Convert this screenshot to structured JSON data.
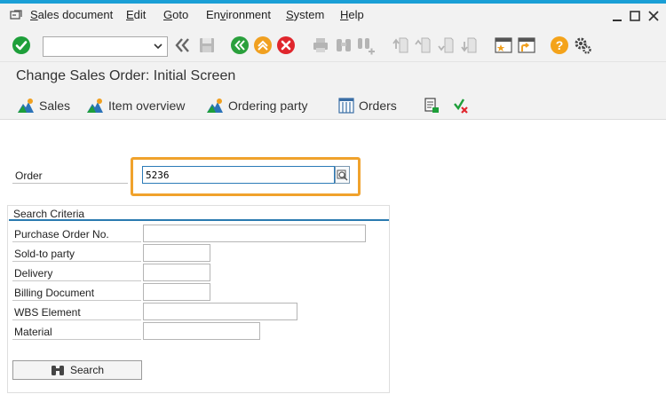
{
  "colors": {
    "accent": "#1a9fd6",
    "highlight": "#f0a22c",
    "success": "#1e9f3a",
    "nav_green": "#2aa03c",
    "exit_orange": "#f0a020",
    "cancel_red": "#e0262d",
    "help_orange": "#f4a31a"
  },
  "menubar": {
    "items": [
      {
        "mnemonic": "S",
        "rest": "ales document"
      },
      {
        "mnemonic": "E",
        "rest": "dit"
      },
      {
        "mnemonic": "G",
        "rest": "oto"
      },
      {
        "pre": "En",
        "mnemonic": "v",
        "rest": "ironment"
      },
      {
        "mnemonic": "S",
        "rest": "ystem"
      },
      {
        "mnemonic": "H",
        "rest": "elp"
      }
    ],
    "window_controls": [
      "minimize-icon",
      "maximize-icon",
      "close-icon"
    ]
  },
  "toolbar": {
    "command_field_value": "",
    "icons": [
      "enter-icon",
      "back-double-arrow-icon",
      "save-icon",
      "back-icon",
      "exit-icon",
      "cancel-icon",
      "print-icon",
      "find-icon",
      "find-next-icon",
      "first-page-icon",
      "previous-page-icon",
      "next-page-icon",
      "last-page-icon",
      "create-session-icon",
      "shortcut-icon",
      "help-icon",
      "settings-icon"
    ]
  },
  "title": "Change Sales Order: Initial Screen",
  "app_toolbar": {
    "sales": "Sales",
    "item_overview": "Item overview",
    "ordering_party": "Ordering party",
    "orders": "Orders"
  },
  "form": {
    "order_label": "Order",
    "order_value": "5236"
  },
  "search_criteria": {
    "title": "Search Criteria",
    "fields": [
      {
        "label": "Purchase Order No.",
        "value": ""
      },
      {
        "label": "Sold-to party",
        "value": ""
      },
      {
        "label": "Delivery",
        "value": ""
      },
      {
        "label": "Billing Document",
        "value": ""
      },
      {
        "label": "WBS Element",
        "value": ""
      },
      {
        "label": "Material",
        "value": ""
      }
    ],
    "search_button": "Search"
  }
}
